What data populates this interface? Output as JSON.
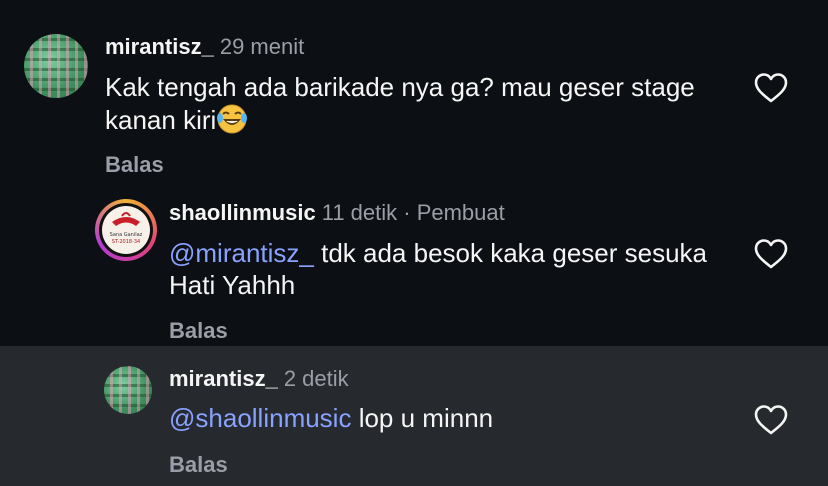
{
  "comments": [
    {
      "username": "mirantisz_",
      "time": "29 menit",
      "text": "Kak tengah ada barikade nya ga? mau geser stage kanan kiri",
      "emoji": "face-with-tears-of-joy",
      "reply_label": "Balas"
    },
    {
      "username": "shaollinmusic",
      "time": "11 detik · Pembuat",
      "mention": "@mirantisz_",
      "text": " tdk ada besok kaka geser sesuka Hati Yahhh",
      "reply_label": "Balas",
      "avatar_text": [
        "Sana Ganilaz",
        "ST-2018-34"
      ]
    },
    {
      "username": "mirantisz_",
      "time": "2 detik",
      "mention": "@shaollinmusic",
      "text": " lop u minnn",
      "reply_label": "Balas"
    }
  ],
  "colors": {
    "background": "#0c0f14",
    "highlight_background": "#26292e",
    "mention": "#8aa2ff",
    "secondary_text": "#9a9ea6"
  },
  "icons": [
    "heart-outline-icon"
  ]
}
